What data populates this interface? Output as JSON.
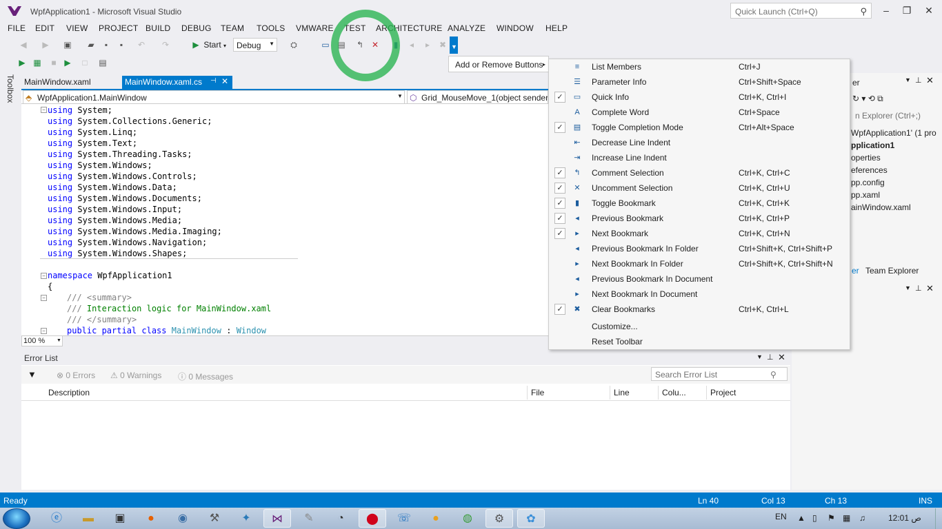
{
  "window": {
    "title": "WpfApplication1 - Microsoft Visual Studio",
    "quick_launch_placeholder": "Quick Launch (Ctrl+Q)"
  },
  "menu": [
    "FILE",
    "EDIT",
    "VIEW",
    "PROJECT",
    "BUILD",
    "DEBUG",
    "TEAM",
    "TOOLS",
    "VMWARE",
    "TEST",
    "ARCHITECTURE",
    "ANALYZE",
    "WINDOW",
    "HELP"
  ],
  "toolbar": {
    "start_label": "Start",
    "config_value": "Debug",
    "add_remove_label": "Add or Remove Buttons"
  },
  "side": {
    "toolbox_label": "Toolbox"
  },
  "tabs": [
    {
      "label": "MainWindow.xaml"
    },
    {
      "label": "MainWindow.xaml.cs"
    }
  ],
  "nav": {
    "class_value": "WpfApplication1.MainWindow",
    "member_value": "Grid_MouseMove_1(object sender,"
  },
  "code": {
    "using_kw": "using",
    "usings": [
      "System;",
      "System.Collections.Generic;",
      "System.Linq;",
      "System.Text;",
      "System.Threading.Tasks;",
      "System.Windows;",
      "System.Windows.Controls;",
      "System.Windows.Data;",
      "System.Windows.Documents;",
      "System.Windows.Input;",
      "System.Windows.Media;",
      "System.Windows.Media.Imaging;",
      "System.Windows.Navigation;",
      "System.Windows.Shapes;"
    ],
    "namespace_kw": "namespace",
    "namespace_name": "WpfApplication1",
    "open_brace": "{",
    "doc_prefix": "///",
    "summary_open": "<summary>",
    "summary_text": "Interaction logic for MainWindow.xaml",
    "summary_close": "</summary>",
    "class_kw": "public partial class",
    "class_name": "MainWindow",
    "colon": ":",
    "base_class": "Window"
  },
  "zoom": "100 %",
  "error_list": {
    "title": "Error List",
    "errors": "0 Errors",
    "warnings": "0 Warnings",
    "messages": "0 Messages",
    "search_placeholder": "Search Error List",
    "columns": [
      "Description",
      "File",
      "Line",
      "Colu...",
      "Project"
    ]
  },
  "solution": {
    "header_fragment": "er",
    "search_fragment": "n Explorer (Ctrl+;)",
    "items": [
      "WpfApplication1' (1 pro",
      "pplication1",
      "operties",
      "eferences",
      "pp.config",
      "pp.xaml",
      "ainWindow.xaml"
    ],
    "tab_fragment": "er",
    "team_explorer": "Team Explorer"
  },
  "menu_popup": {
    "items": [
      {
        "label": "List Members",
        "shortcut": "Ctrl+J",
        "checked": false,
        "icon": "list-members-icon",
        "glyph": "≡"
      },
      {
        "label": "Parameter Info",
        "shortcut": "Ctrl+Shift+Space",
        "checked": false,
        "icon": "parameter-info-icon",
        "glyph": "☰"
      },
      {
        "label": "Quick Info",
        "shortcut": "Ctrl+K, Ctrl+I",
        "checked": true,
        "icon": "quick-info-icon",
        "glyph": "▭"
      },
      {
        "label": "Complete Word",
        "shortcut": "Ctrl+Space",
        "checked": false,
        "icon": "complete-word-icon",
        "glyph": "A"
      },
      {
        "label": "Toggle Completion Mode",
        "shortcut": "Ctrl+Alt+Space",
        "checked": true,
        "icon": "completion-mode-icon",
        "glyph": "▤"
      },
      {
        "label": "Decrease Line Indent",
        "shortcut": "",
        "checked": false,
        "icon": "decrease-indent-icon",
        "glyph": "⇤"
      },
      {
        "label": "Increase Line Indent",
        "shortcut": "",
        "checked": false,
        "icon": "increase-indent-icon",
        "glyph": "⇥"
      },
      {
        "label": "Comment Selection",
        "shortcut": "Ctrl+K, Ctrl+C",
        "checked": true,
        "icon": "comment-icon",
        "glyph": "↰"
      },
      {
        "label": "Uncomment Selection",
        "shortcut": "Ctrl+K, Ctrl+U",
        "checked": true,
        "icon": "uncomment-icon",
        "glyph": "✕"
      },
      {
        "label": "Toggle Bookmark",
        "shortcut": "Ctrl+K, Ctrl+K",
        "checked": true,
        "icon": "bookmark-icon",
        "glyph": "▮"
      },
      {
        "label": "Previous Bookmark",
        "shortcut": "Ctrl+K, Ctrl+P",
        "checked": true,
        "icon": "previous-bookmark-icon",
        "glyph": "◂"
      },
      {
        "label": "Next Bookmark",
        "shortcut": "Ctrl+K, Ctrl+N",
        "checked": true,
        "icon": "next-bookmark-icon",
        "glyph": "▸"
      },
      {
        "label": "Previous Bookmark In Folder",
        "shortcut": "Ctrl+Shift+K, Ctrl+Shift+P",
        "checked": false,
        "icon": "previous-bookmark-folder-icon",
        "glyph": "◂"
      },
      {
        "label": "Next Bookmark In Folder",
        "shortcut": "Ctrl+Shift+K, Ctrl+Shift+N",
        "checked": false,
        "icon": "next-bookmark-folder-icon",
        "glyph": "▸"
      },
      {
        "label": "Previous Bookmark In Document",
        "shortcut": "",
        "checked": false,
        "icon": "previous-bookmark-document-icon",
        "glyph": "◂"
      },
      {
        "label": "Next Bookmark In Document",
        "shortcut": "",
        "checked": false,
        "icon": "next-bookmark-document-icon",
        "glyph": "▸"
      },
      {
        "label": "Clear Bookmarks",
        "shortcut": "Ctrl+K, Ctrl+L",
        "checked": true,
        "icon": "clear-bookmarks-icon",
        "glyph": "✖"
      }
    ],
    "customize": "Customize...",
    "reset": "Reset Toolbar"
  },
  "status": {
    "state": "Ready",
    "line": "Ln 40",
    "col": "Col 13",
    "ch": "Ch 13",
    "mode": "INS"
  },
  "taskbar": {
    "lang": "EN",
    "time": "12:01 ص"
  },
  "colors": {
    "accent": "#007acc",
    "annotation": "#28b450",
    "keyword": "#0000ff",
    "comment": "#008000",
    "type": "#2b91af"
  }
}
